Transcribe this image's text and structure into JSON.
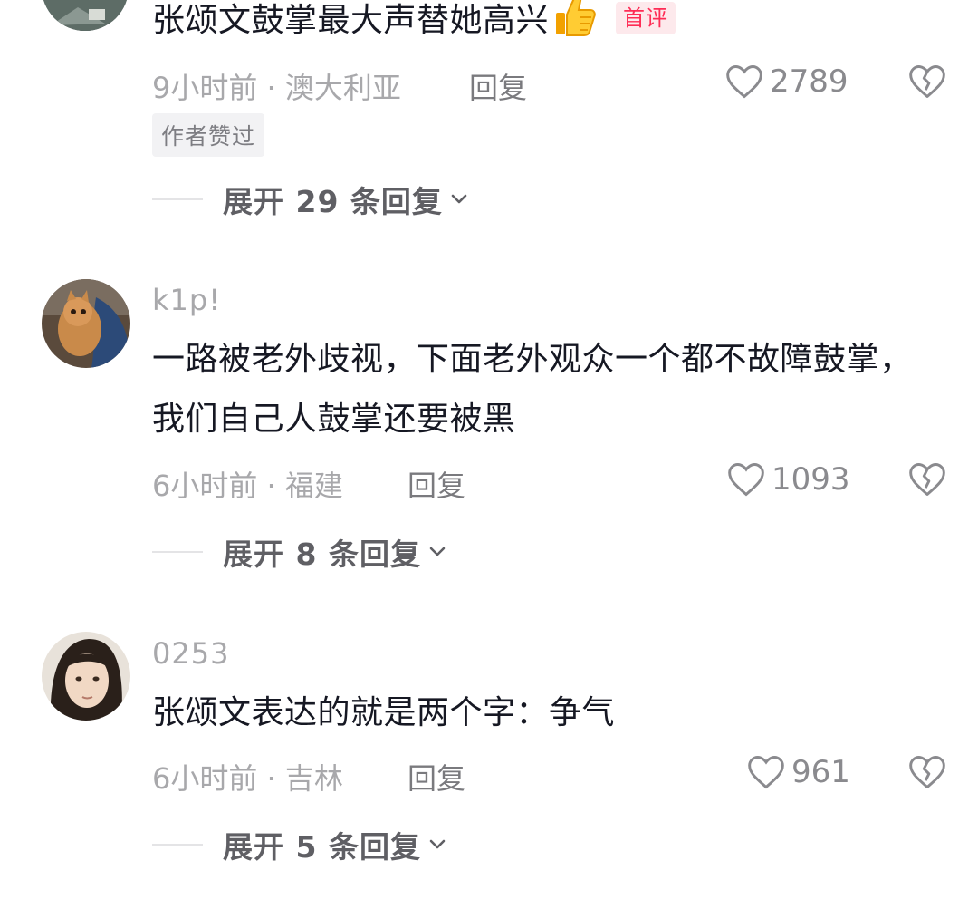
{
  "comments": [
    {
      "text": "张颂文鼓掌最大声替她高兴",
      "emoji": "thumbs-up-icon",
      "badge": "首评",
      "time_location": "9小时前 · 澳大利亚",
      "reply_label": "回复",
      "likes": "2789",
      "author_liked": "作者赞过",
      "expand_label": "展开 29 条回复"
    },
    {
      "username": "k1p!",
      "text": "一路被老外歧视，下面老外观众一个都不故障鼓掌，我们自己人鼓掌还要被黑",
      "time_location": "6小时前 · 福建",
      "reply_label": "回复",
      "likes": "1093",
      "expand_label": "展开 8 条回复"
    },
    {
      "username": "0253",
      "text": "张颂文表达的就是两个字：争气",
      "time_location": "6小时前 · 吉林",
      "reply_label": "回复",
      "likes": "961",
      "expand_label": "展开 5 条回复"
    }
  ],
  "colors": {
    "text_primary": "#161823",
    "text_secondary": "#a8a8ab",
    "badge_red": "#fe2c55",
    "badge_bg": "#fde9ec"
  }
}
